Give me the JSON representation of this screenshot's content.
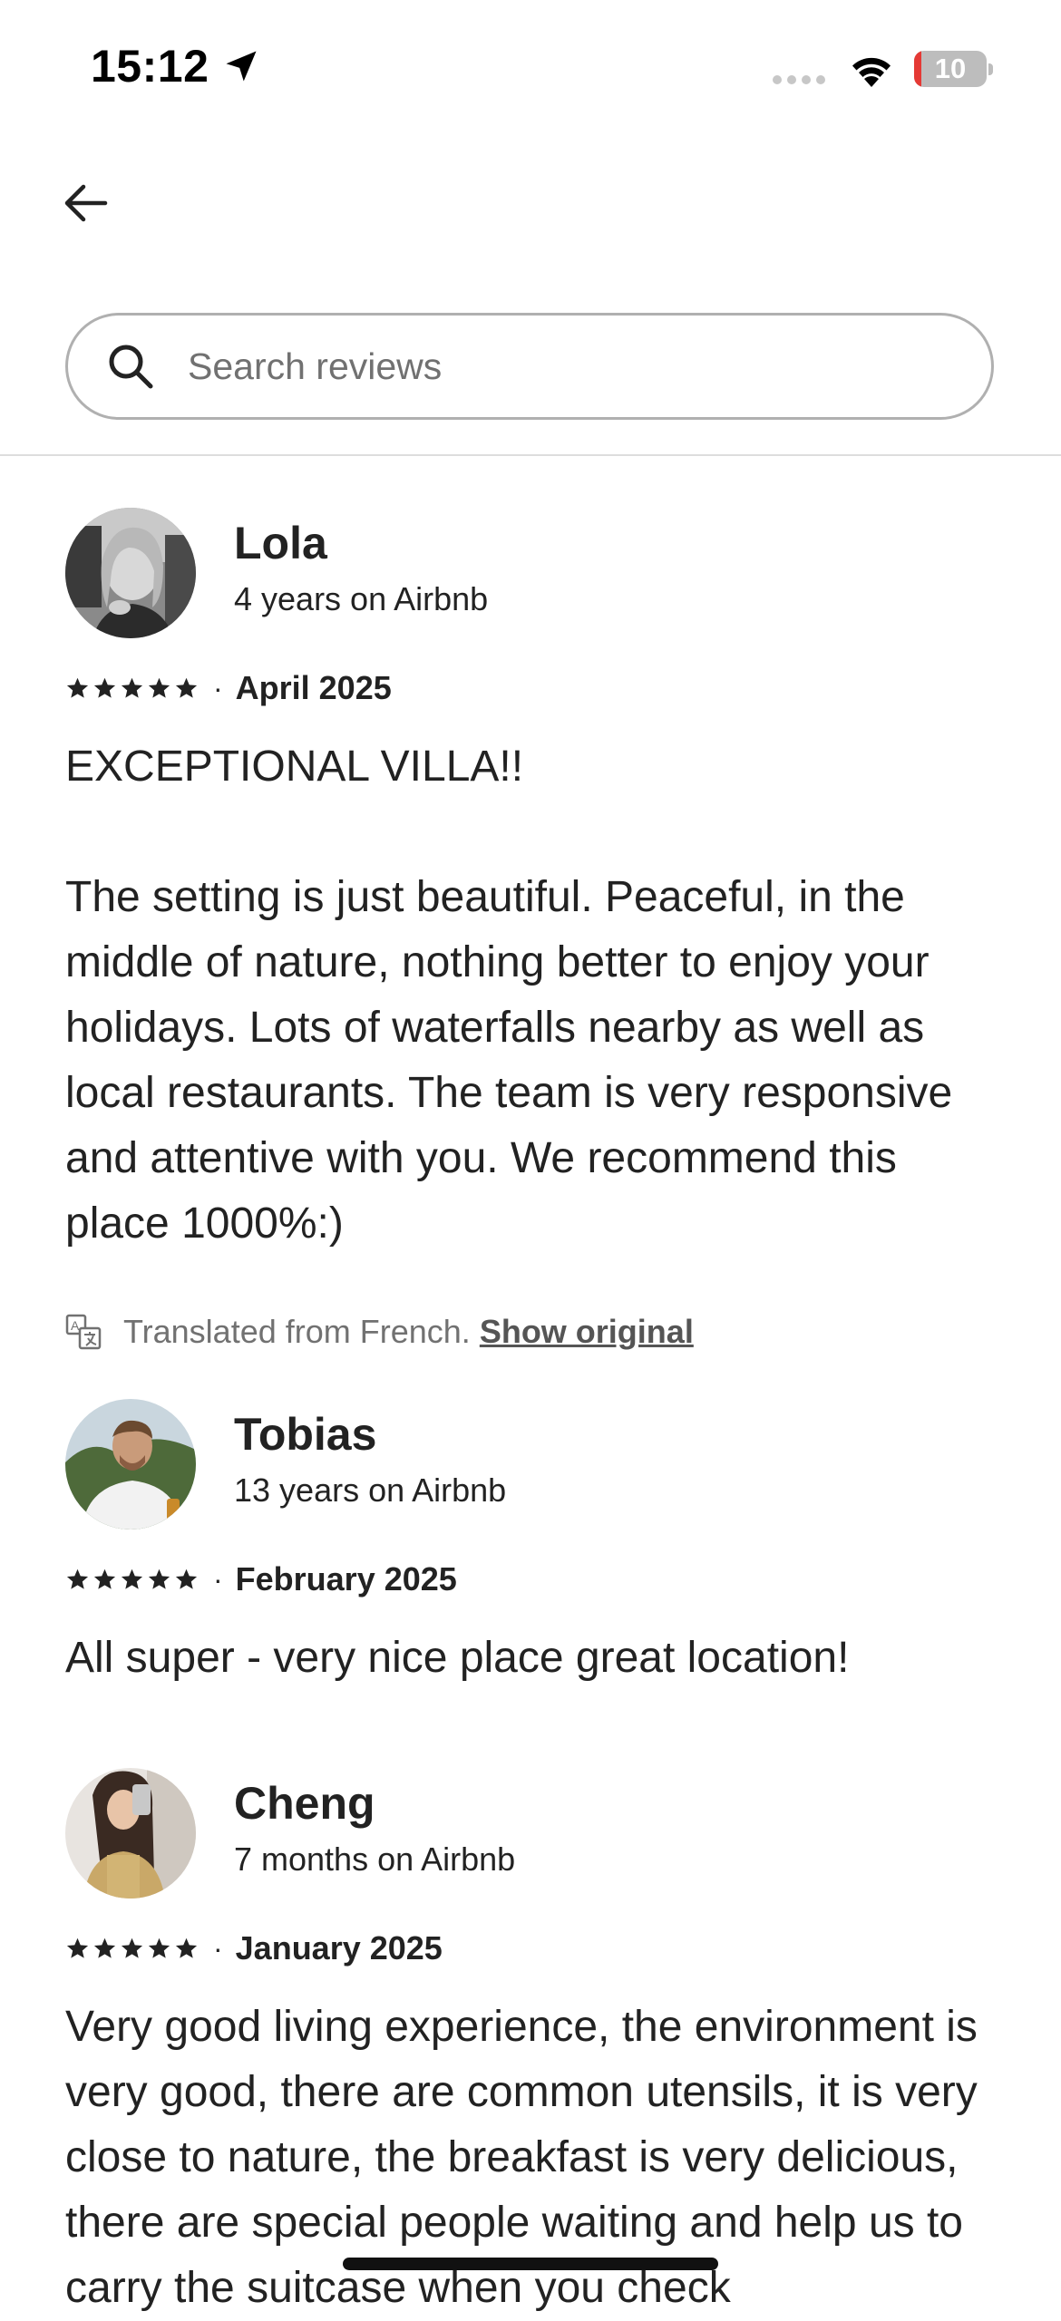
{
  "status_bar": {
    "time": "15:12",
    "battery": "10"
  },
  "search": {
    "placeholder": "Search reviews"
  },
  "reviews": [
    {
      "name": "Lola",
      "tenure": "4 years on Airbnb",
      "rating": 5,
      "date": "April 2025",
      "text": "EXCEPTIONAL VILLA!!\n\nThe setting is just beautiful. Peaceful, in the middle of nature, nothing better to enjoy your holidays. Lots of waterfalls nearby as well as local restaurants. The team is very responsive and attentive with you. We recommend this place 1000%:)",
      "translation_note": "Translated from French.",
      "show_original": "Show original"
    },
    {
      "name": "Tobias",
      "tenure": "13 years on Airbnb",
      "rating": 5,
      "date": "February 2025",
      "text": "All super - very nice place great location!"
    },
    {
      "name": "Cheng",
      "tenure": "7 months on Airbnb",
      "rating": 5,
      "date": "January 2025",
      "text": "Very good living experience, the environment is very good, there are common utensils, it is very close to nature, the breakfast is very delicious, there are special people waiting and help us to carry the suitcase when you check"
    }
  ],
  "dot_separator": "·",
  "colors": {
    "text": "#222222",
    "secondary": "#717171",
    "border": "#b0b0b0",
    "battery_low": "#e53935"
  }
}
